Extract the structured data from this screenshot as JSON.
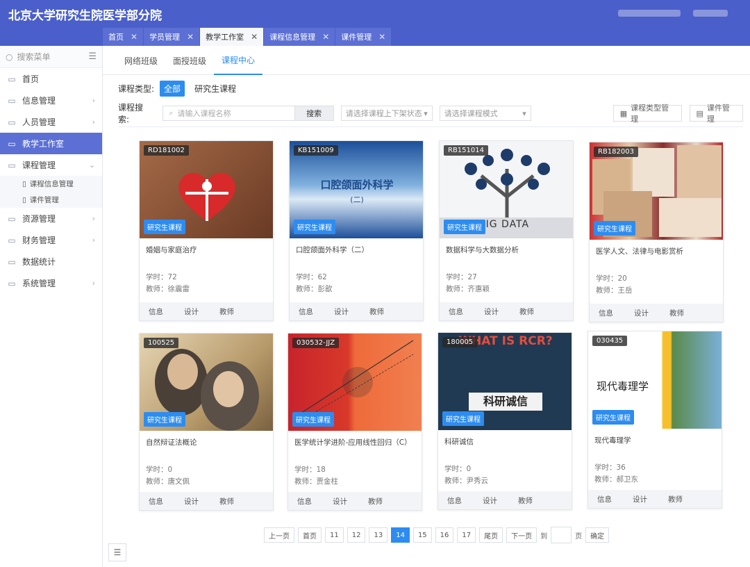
{
  "header": {
    "title": "北京大学研究生院医学部分院"
  },
  "tabs": [
    {
      "label": "首页"
    },
    {
      "label": "学员管理"
    },
    {
      "label": "教学工作室"
    },
    {
      "label": "课程信息管理"
    },
    {
      "label": "课件管理"
    }
  ],
  "sidebar": {
    "search_placeholder": "搜索菜单",
    "items": [
      {
        "label": "首页"
      },
      {
        "label": "信息管理"
      },
      {
        "label": "人员管理"
      },
      {
        "label": "教学工作室"
      },
      {
        "label": "课程管理"
      },
      {
        "label": "资源管理"
      },
      {
        "label": "财务管理"
      },
      {
        "label": "数据统计"
      },
      {
        "label": "系统管理"
      }
    ],
    "subitems": [
      {
        "label": "课程信息管理"
      },
      {
        "label": "课件管理"
      }
    ]
  },
  "subtabs": [
    {
      "label": "网络班级"
    },
    {
      "label": "面授班级"
    },
    {
      "label": "课程中心"
    }
  ],
  "filters": {
    "type_label": "课程类型:",
    "type_all": "全部",
    "type_grad": "研究生课程",
    "search_label": "课程搜索:",
    "search_placeholder": "请输入课程名称",
    "search_button": "搜索",
    "status_placeholder": "请选择课程上下架状态",
    "mode_placeholder": "请选择课程模式",
    "type_mgmt": "课程类型管理",
    "courseware_mgmt": "课件管理"
  },
  "card_actions": {
    "info": "信息",
    "design": "设计",
    "teacher": "教师"
  },
  "courses": [
    {
      "code": "RD181002",
      "tag": "研究生课程",
      "name": "婚姻与家庭治疗",
      "hours": "学时：72",
      "teacher": "教师：徐震雷"
    },
    {
      "code": "KB151009",
      "tag": "研究生课程",
      "name": "口腔颌面外科学（二）",
      "hours": "学时：62",
      "teacher": "教师：彭歆",
      "thumb_title": "口腔颌面外科学",
      "thumb_sub": "(二)"
    },
    {
      "code": "RB151014",
      "tag": "研究生课程",
      "name": "数据科学与大数据分析",
      "hours": "学时：27",
      "teacher": "教师：齐惠颖",
      "thumb_title": "BIG DATA"
    },
    {
      "code": "RB182003",
      "tag": "研究生课程",
      "name": "医学人文、法律与电影赏析",
      "hours": "学时：20",
      "teacher": "教师：王岳"
    },
    {
      "code": "100525",
      "tag": "研究生课程",
      "name": "自然辩证法概论",
      "hours": "学时：0",
      "teacher": "教师：唐文佩"
    },
    {
      "code": "030532-JJZ",
      "tag": "研究生课程",
      "name": "医学统计学进阶-应用线性回归（C）",
      "hours": "学时：18",
      "teacher": "教师：贾金柱"
    },
    {
      "code": "180005",
      "tag": "研究生课程",
      "name": "科研诚信",
      "hours": "学时：0",
      "teacher": "教师：尹秀云",
      "thumb_title": "WHAT IS RCR?",
      "thumb_sub": "科研诚信"
    },
    {
      "code": "030435",
      "tag": "研究生课程",
      "name": "现代毒理学",
      "hours": "学时：36",
      "teacher": "教师：郝卫东",
      "thumb_title": "现代毒理学"
    }
  ],
  "pager": {
    "prev": "上一页",
    "first": "首页",
    "pages": [
      "11",
      "12",
      "13",
      "14",
      "15",
      "16",
      "17"
    ],
    "current": "14",
    "last": "尾页",
    "next": "下一页",
    "goto": "到",
    "page_unit": "页",
    "confirm": "确定"
  }
}
